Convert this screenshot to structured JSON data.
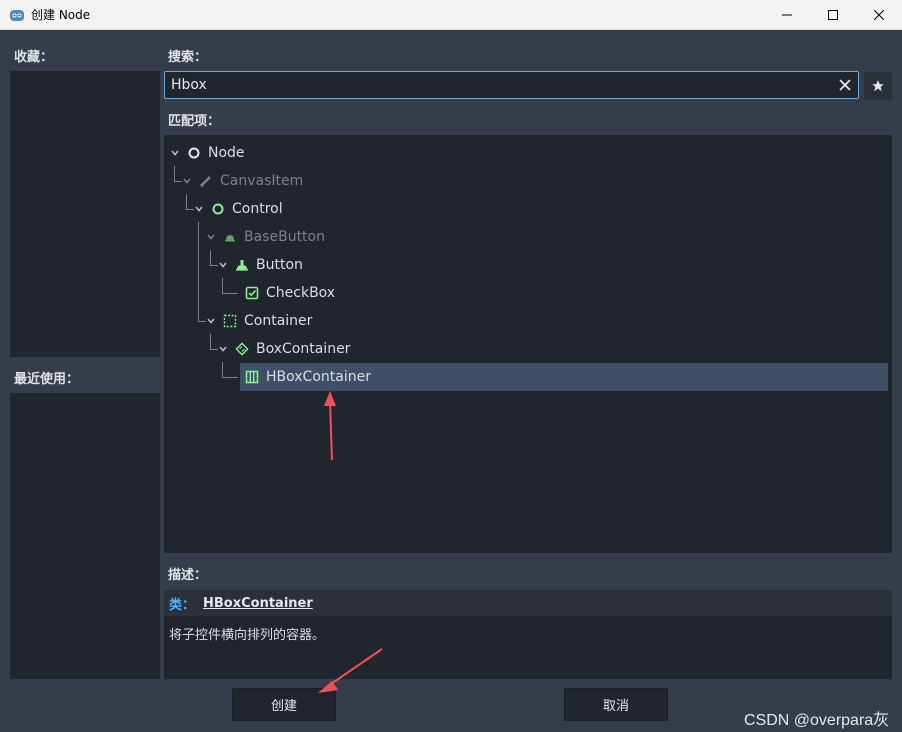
{
  "window": {
    "title": "创建 Node",
    "minimize_icon": "minimize-icon",
    "maximize_icon": "maximize-icon",
    "close_icon": "close-icon"
  },
  "left": {
    "favorites_label": "收藏：",
    "recent_label": "最近使用："
  },
  "search": {
    "label": "搜索：",
    "value": "Hbox",
    "clear_icon": "close-icon",
    "favorite_icon": "star-icon"
  },
  "matches": {
    "label": "匹配项：",
    "items": [
      {
        "label": "Node",
        "icon": "node-circle-icon",
        "dim": false
      },
      {
        "label": "CanvasItem",
        "icon": "brush-icon",
        "dim": true
      },
      {
        "label": "Control",
        "icon": "control-circle-icon",
        "dim": false
      },
      {
        "label": "BaseButton",
        "icon": "base-button-icon",
        "dim": true
      },
      {
        "label": "Button",
        "icon": "button-icon",
        "dim": false
      },
      {
        "label": "CheckBox",
        "icon": "checkbox-icon",
        "dim": false
      },
      {
        "label": "Container",
        "icon": "container-icon",
        "dim": false
      },
      {
        "label": "BoxContainer",
        "icon": "box-container-icon",
        "dim": false
      },
      {
        "label": "HBoxContainer",
        "icon": "hbox-container-icon",
        "dim": false,
        "selected": true
      }
    ]
  },
  "description": {
    "label": "描述：",
    "class_key": "类：",
    "class_name": "HBoxContainer",
    "text": "将子控件横向排列的容器。"
  },
  "buttons": {
    "create": "创建",
    "cancel": "取消"
  },
  "watermark": "CSDN @overpara灰",
  "colors": {
    "accent": "#6aa8e6",
    "selection": "#3f4f66",
    "green_icon": "#8eef97",
    "annotation": "#f0505a"
  }
}
